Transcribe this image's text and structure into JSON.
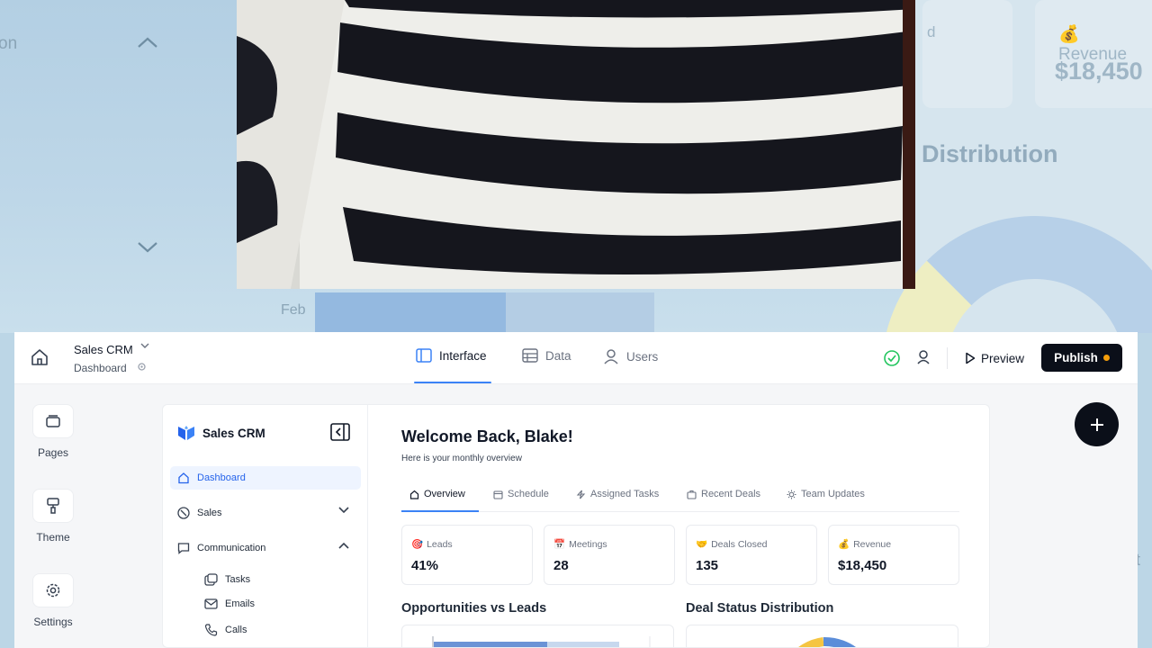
{
  "background": {
    "partial_label": "on",
    "stat_partial_letter": "d",
    "revenue_label": "Revenue",
    "revenue_value": "$18,450",
    "chart_title_partial": "Distribution",
    "month_label": "Feb",
    "edge_letter": "t"
  },
  "video": {
    "subject": "striped-sweater-closeup"
  },
  "topbar": {
    "app_name": "Sales CRM",
    "page_name": "Dashboard",
    "tabs": [
      {
        "label": "Interface",
        "icon": "layout-icon",
        "active": true
      },
      {
        "label": "Data",
        "icon": "table-icon",
        "active": false
      },
      {
        "label": "Users",
        "icon": "user-icon",
        "active": false
      }
    ],
    "preview_label": "Preview",
    "publish_label": "Publish",
    "accent": "#3b82f6",
    "publish_dot_color": "#f59e0b"
  },
  "rail": {
    "items": [
      {
        "label": "Pages",
        "icon": "pages-icon"
      },
      {
        "label": "Theme",
        "icon": "paint-roller-icon"
      },
      {
        "label": "Settings",
        "icon": "gear-icon"
      }
    ]
  },
  "crm": {
    "brand": "Sales CRM",
    "nav": {
      "dashboard": "Dashboard",
      "sales": "Sales",
      "communication": "Communication",
      "sub": [
        "Tasks",
        "Emails",
        "Calls"
      ]
    },
    "welcome": "Welcome Back, Blake!",
    "subtitle": "Here is your monthly overview",
    "tabs": [
      "Overview",
      "Schedule",
      "Assigned Tasks",
      "Recent Deals",
      "Team Updates"
    ],
    "kpis": [
      {
        "label": "Leads",
        "value": "41%",
        "emoji": "🎯"
      },
      {
        "label": "Meetings",
        "value": "28",
        "emoji": "📅"
      },
      {
        "label": "Deals Closed",
        "value": "135",
        "emoji": "🤝"
      },
      {
        "label": "Revenue",
        "value": "$18,450",
        "emoji": "💰"
      }
    ],
    "sections": {
      "opportunities": "Opportunities vs Leads",
      "deal_status": "Deal Status Distribution"
    }
  }
}
